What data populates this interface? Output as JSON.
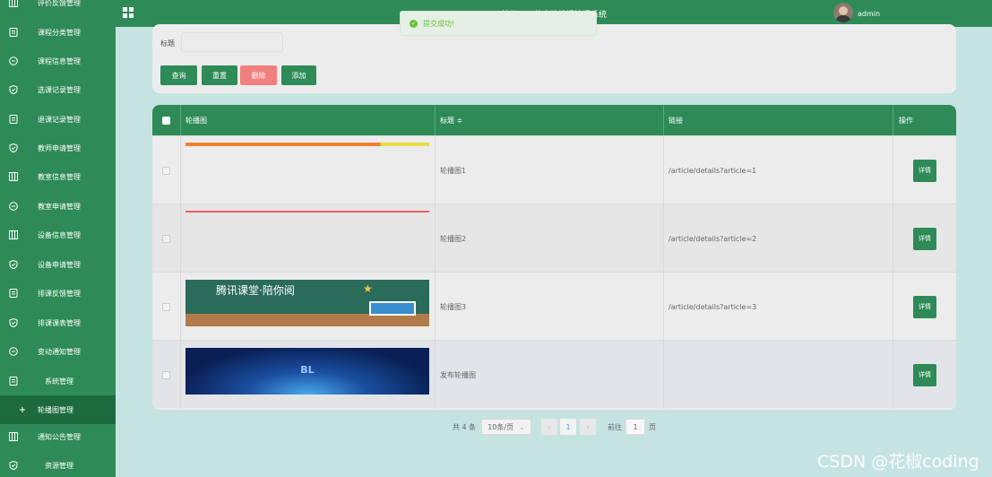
{
  "sidebar": {
    "items": [
      {
        "label": "评价反馈管理",
        "icon": "columns-icon"
      },
      {
        "label": "课程分类管理",
        "icon": "document-icon"
      },
      {
        "label": "课程信息管理",
        "icon": "chat-icon"
      },
      {
        "label": "选课记录管理",
        "icon": "shield-check-icon"
      },
      {
        "label": "退课记录管理",
        "icon": "document-icon"
      },
      {
        "label": "教师申请管理",
        "icon": "shield-check-icon"
      },
      {
        "label": "教室信息管理",
        "icon": "columns-icon"
      },
      {
        "label": "教室申请管理",
        "icon": "chat-icon"
      },
      {
        "label": "设备信息管理",
        "icon": "columns-icon"
      },
      {
        "label": "设备申请管理",
        "icon": "shield-check-icon"
      },
      {
        "label": "排课反馈管理",
        "icon": "document-icon"
      },
      {
        "label": "排课课表管理",
        "icon": "shield-check-icon"
      },
      {
        "label": "变动通知管理",
        "icon": "chat-icon"
      },
      {
        "label": "系统管理",
        "icon": "document-icon"
      },
      {
        "label": "轮播图管理",
        "icon": "plus-icon"
      },
      {
        "label": "通知公告管理",
        "icon": "columns-icon"
      },
      {
        "label": "资源管理",
        "icon": "shield-check-icon"
      }
    ]
  },
  "header": {
    "title": "基于Java的高校排课管理系统",
    "username": "admin"
  },
  "toast": {
    "message": "提交成功!"
  },
  "search": {
    "title_label": "标题",
    "title_value": "",
    "buttons": {
      "query": "查询",
      "reset": "重置",
      "delete": "删除",
      "add": "添加"
    }
  },
  "table": {
    "headers": {
      "image": "轮播图",
      "title": "标题 ≑",
      "link": "链接",
      "action": "操作"
    },
    "rows": [
      {
        "title": "轮播图1",
        "link": "/article/details?article=1",
        "action": "详情"
      },
      {
        "title": "轮播图2",
        "link": "/article/details?article=2",
        "action": "详情"
      },
      {
        "title": "轮播图3",
        "link": "/article/details?article=3",
        "action": "详情"
      },
      {
        "title": "发布轮播图",
        "link": "",
        "action": "详情"
      }
    ],
    "banner3_text": "腾讯课堂·陪你阅",
    "banner4_text": "BL"
  },
  "pagination": {
    "total": "共 4 条",
    "page_size": "10条/页",
    "prev": "‹",
    "current": "1",
    "next": "›",
    "goto_label": "前往",
    "goto_value": "1",
    "page_suffix": "页"
  },
  "watermark": "CSDN @花椒coding",
  "colors": {
    "primary": "#2e8b57",
    "danger": "#f08080",
    "background": "#c5e3e1"
  }
}
